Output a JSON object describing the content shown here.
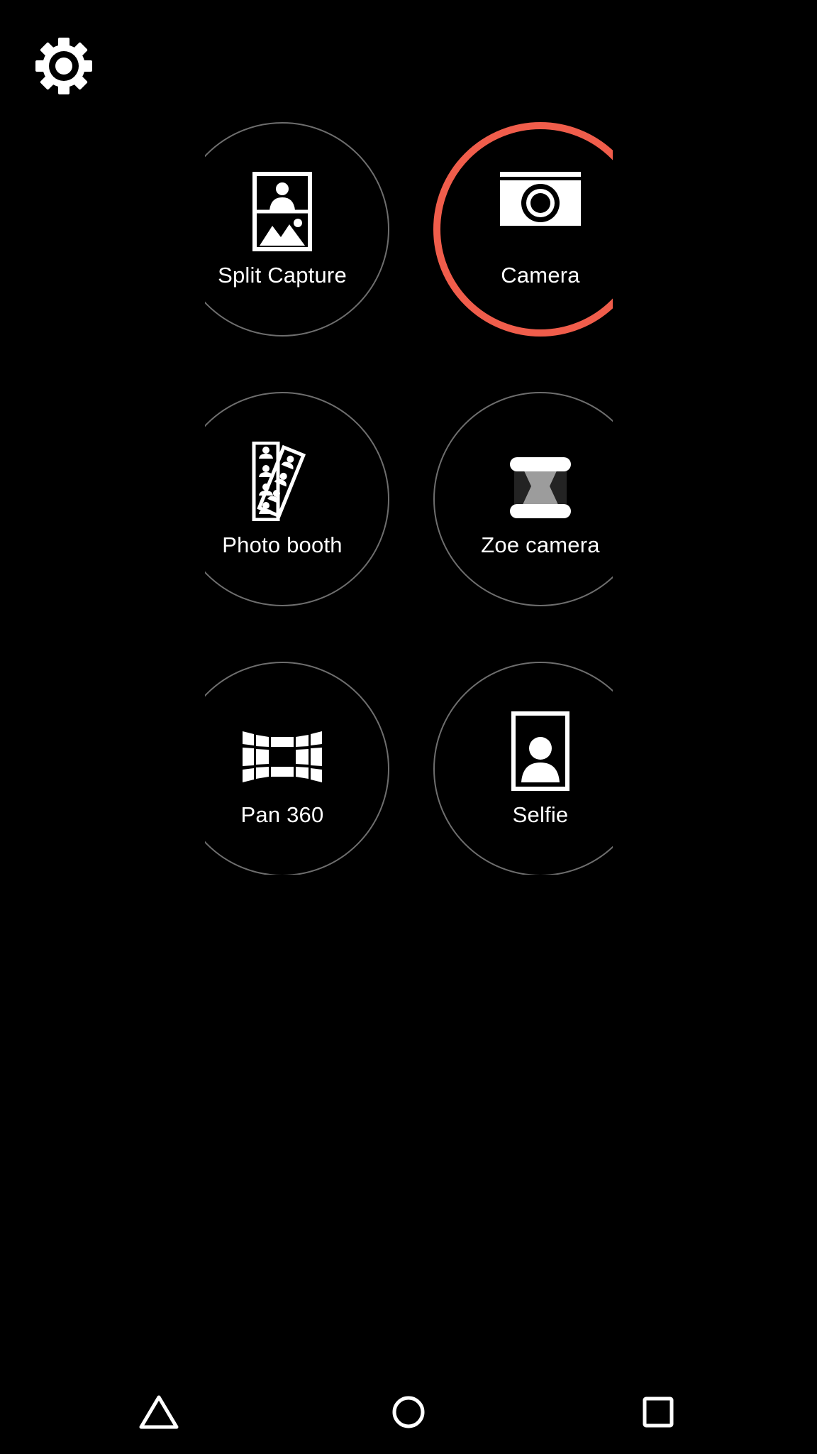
{
  "header": {
    "settings_icon": "gear-icon"
  },
  "modes": [
    {
      "label": "Split Capture",
      "icon": "split-capture-icon",
      "selected": false
    },
    {
      "label": "Camera",
      "icon": "camera-icon",
      "selected": true
    },
    {
      "label": "Photo booth",
      "icon": "photo-booth-icon",
      "selected": false
    },
    {
      "label": "Zoe camera",
      "icon": "zoe-camera-icon",
      "selected": false
    },
    {
      "label": "Pan 360",
      "icon": "pan-360-icon",
      "selected": false
    },
    {
      "label": "Selfie",
      "icon": "selfie-icon",
      "selected": false
    }
  ],
  "navigation": {
    "back_icon": "back-triangle-icon",
    "home_icon": "home-circle-icon",
    "recents_icon": "recents-square-icon"
  },
  "colors": {
    "background": "#000000",
    "accent": "#f05d4b",
    "ring": "#6e6e6e",
    "text": "#ffffff"
  }
}
